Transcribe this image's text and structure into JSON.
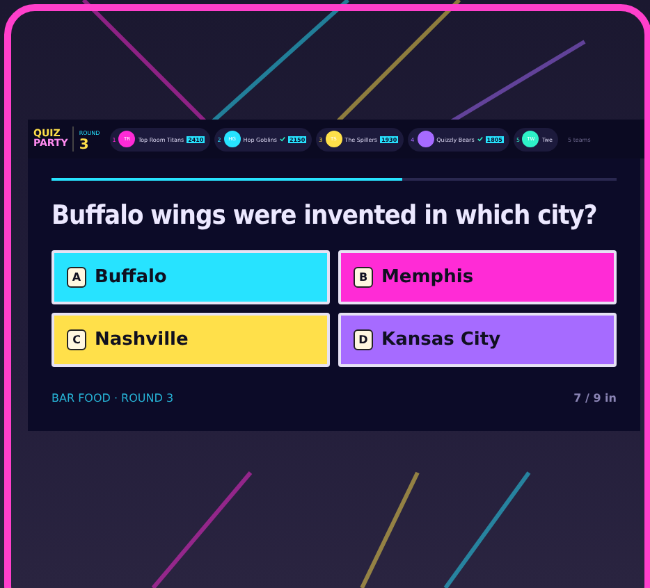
{
  "logo": {
    "top": "QUIZ",
    "bottom": "PARTY"
  },
  "round": {
    "label": "ROUND",
    "number": "3"
  },
  "teams": [
    {
      "rank": "1",
      "initials": "TR",
      "name": "Top Room Titans",
      "answered": false,
      "score": "2410",
      "color": "#ff2bd6"
    },
    {
      "rank": "2",
      "initials": "HG",
      "name": "Hop Goblins",
      "answered": true,
      "score": "2150",
      "color": "#27e3ff"
    },
    {
      "rank": "3",
      "initials": "TS",
      "name": "The Spillers",
      "answered": false,
      "score": "1930",
      "color": "#ffe04a"
    },
    {
      "rank": "4",
      "name": "Quizzly Bears",
      "answered": true,
      "score": "1805",
      "color": "#a66bff"
    },
    {
      "rank": "5",
      "initials": "TW",
      "name": "Twe",
      "answered": false,
      "color": "#2ef2c8"
    }
  ],
  "team_count": "5 teams",
  "progress": {
    "level": 0.62
  },
  "question": "Buffalo wings were invented in which city?",
  "answers": [
    {
      "letter": "A",
      "text": "Buffalo",
      "color": "#27e3ff"
    },
    {
      "letter": "B",
      "text": "Memphis",
      "color": "#ff2bd6"
    },
    {
      "letter": "C",
      "text": "Nashville",
      "color": "#ffe04a"
    },
    {
      "letter": "D",
      "text": "Kansas City",
      "color": "#a66bff"
    }
  ],
  "category": "BAR FOOD · ROUND 3",
  "answered_count": "7 / 9 in"
}
